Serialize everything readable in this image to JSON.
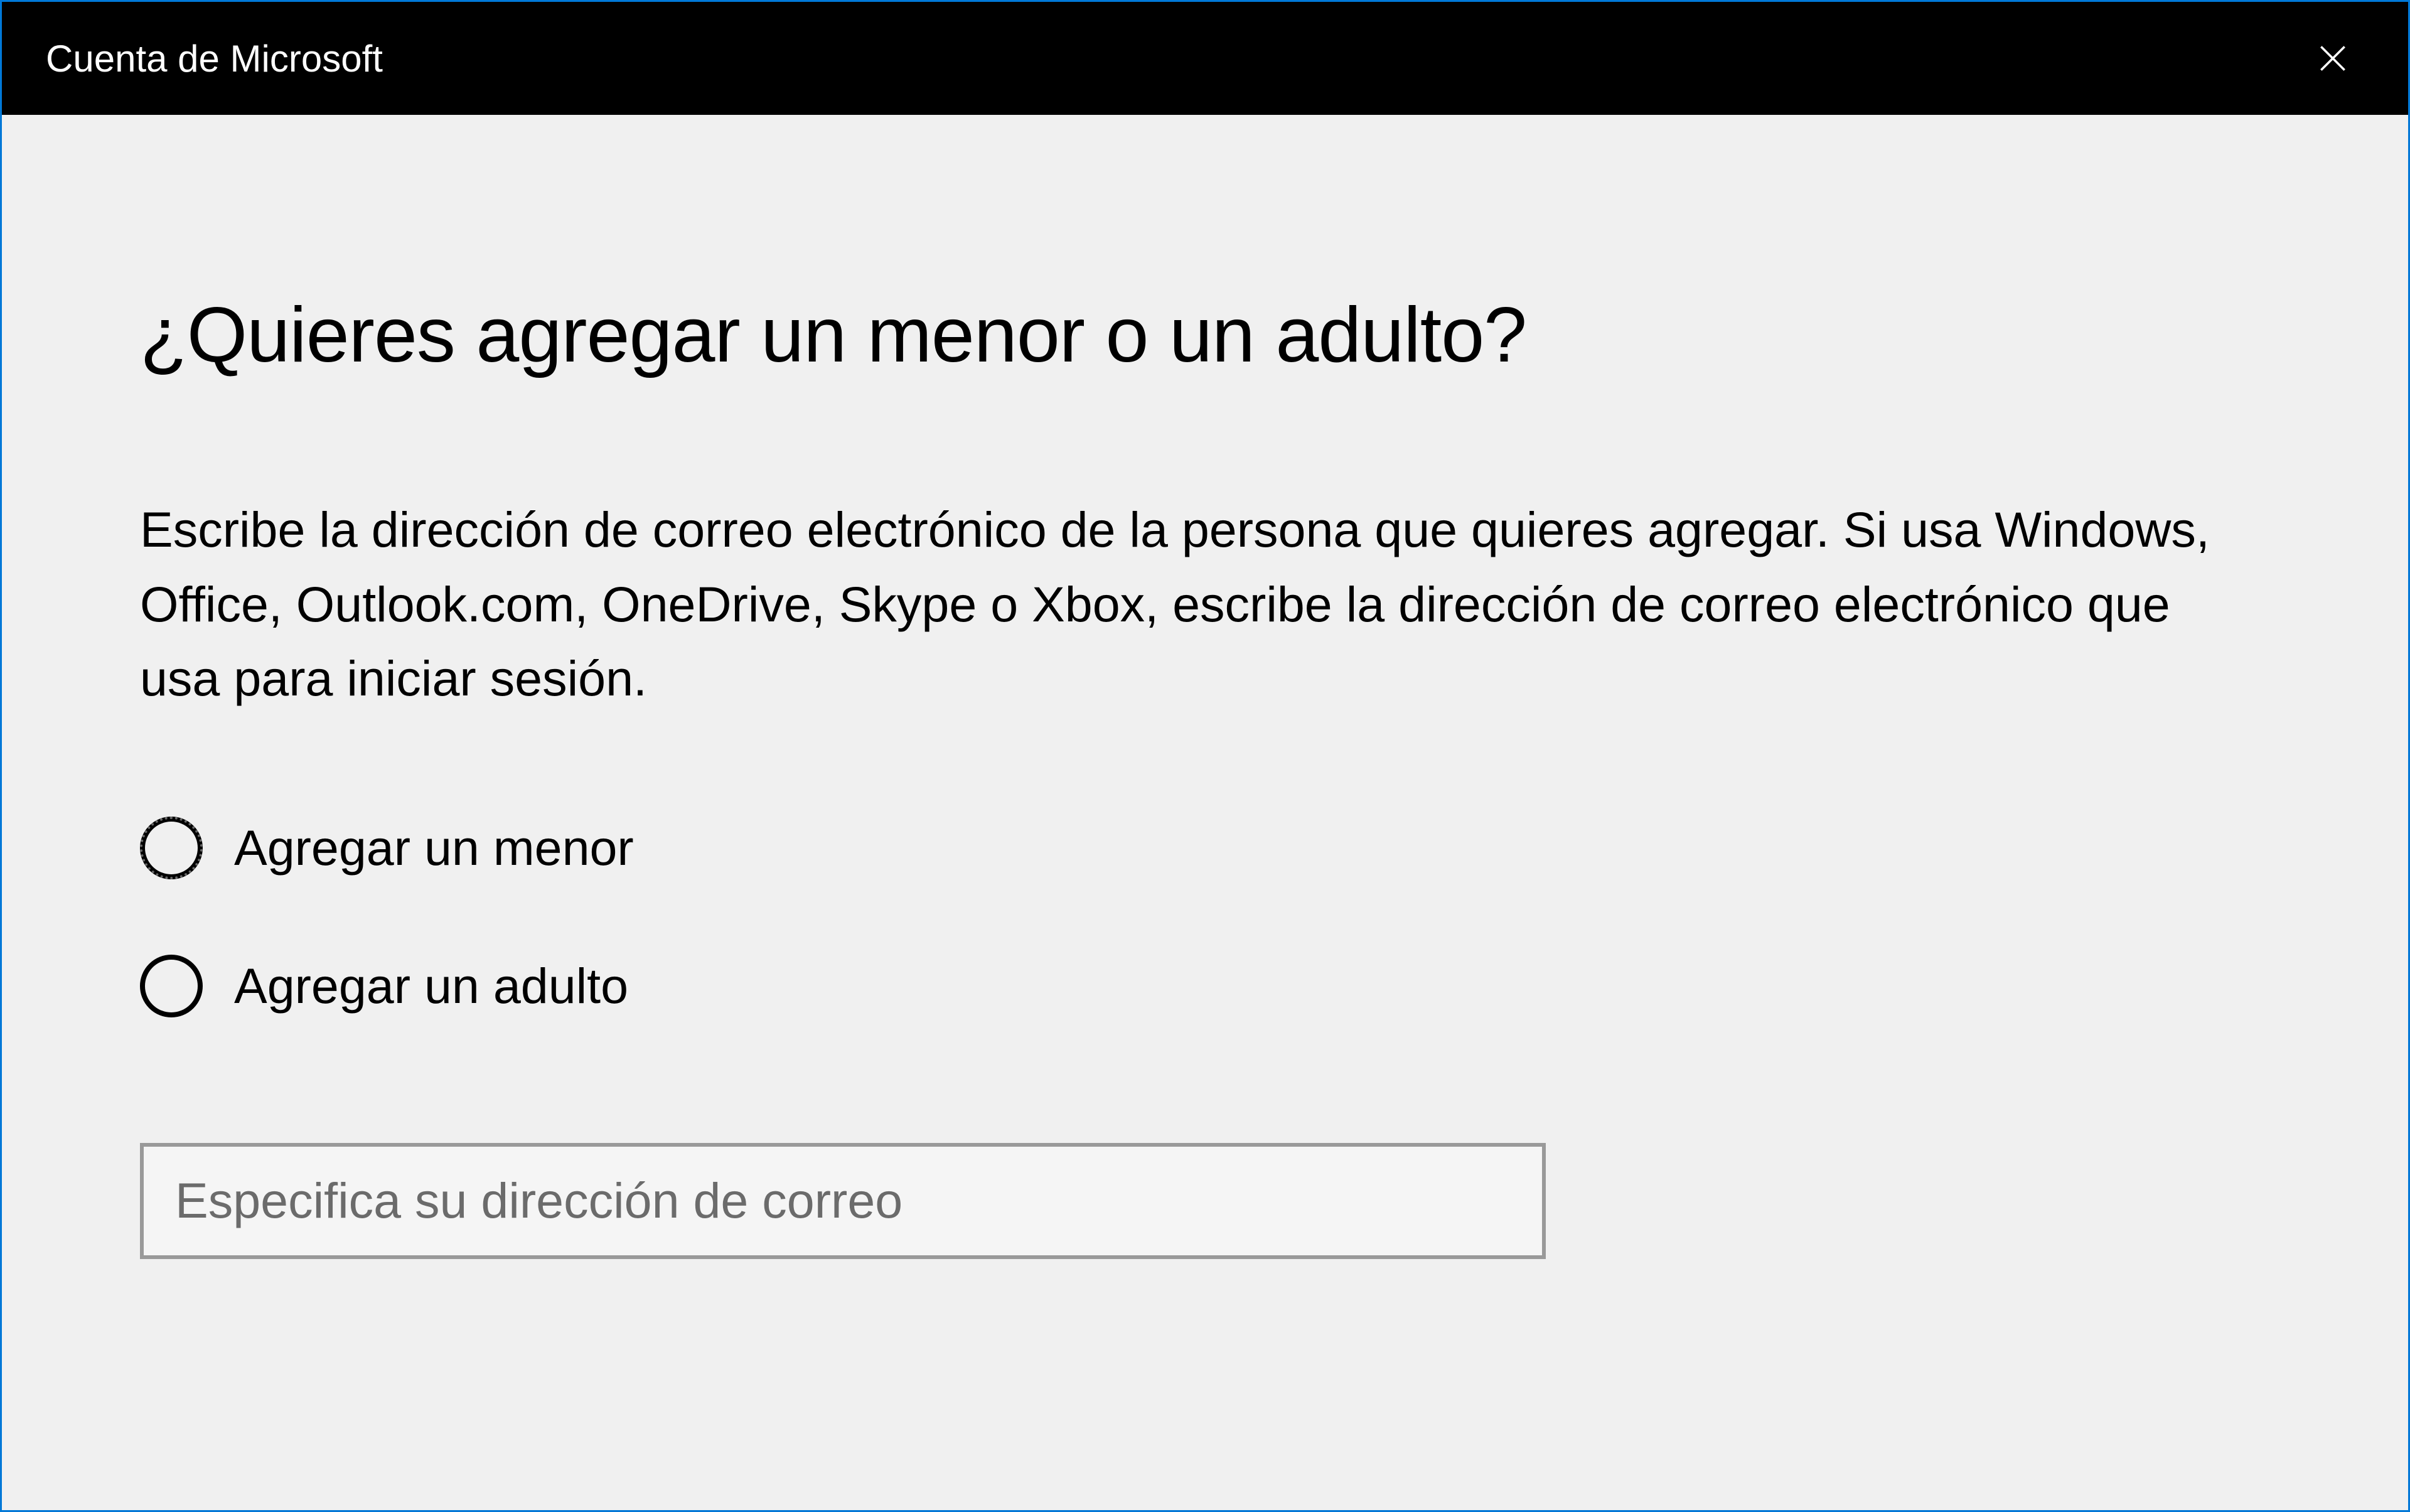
{
  "titleBar": {
    "title": "Cuenta de Microsoft"
  },
  "content": {
    "heading": "¿Quieres agregar un menor o un adulto?",
    "description": "Escribe la dirección de correo electrónico de la persona que quieres agregar. Si usa Windows, Office, Outlook.com, OneDrive, Skype o Xbox, escribe la dirección de correo electrónico que usa para iniciar sesión.",
    "radioOptions": [
      {
        "label": "Agregar un menor",
        "focused": true
      },
      {
        "label": "Agregar un adulto",
        "focused": false
      }
    ],
    "emailInput": {
      "placeholder": "Especifica su dirección de correo",
      "value": ""
    }
  }
}
